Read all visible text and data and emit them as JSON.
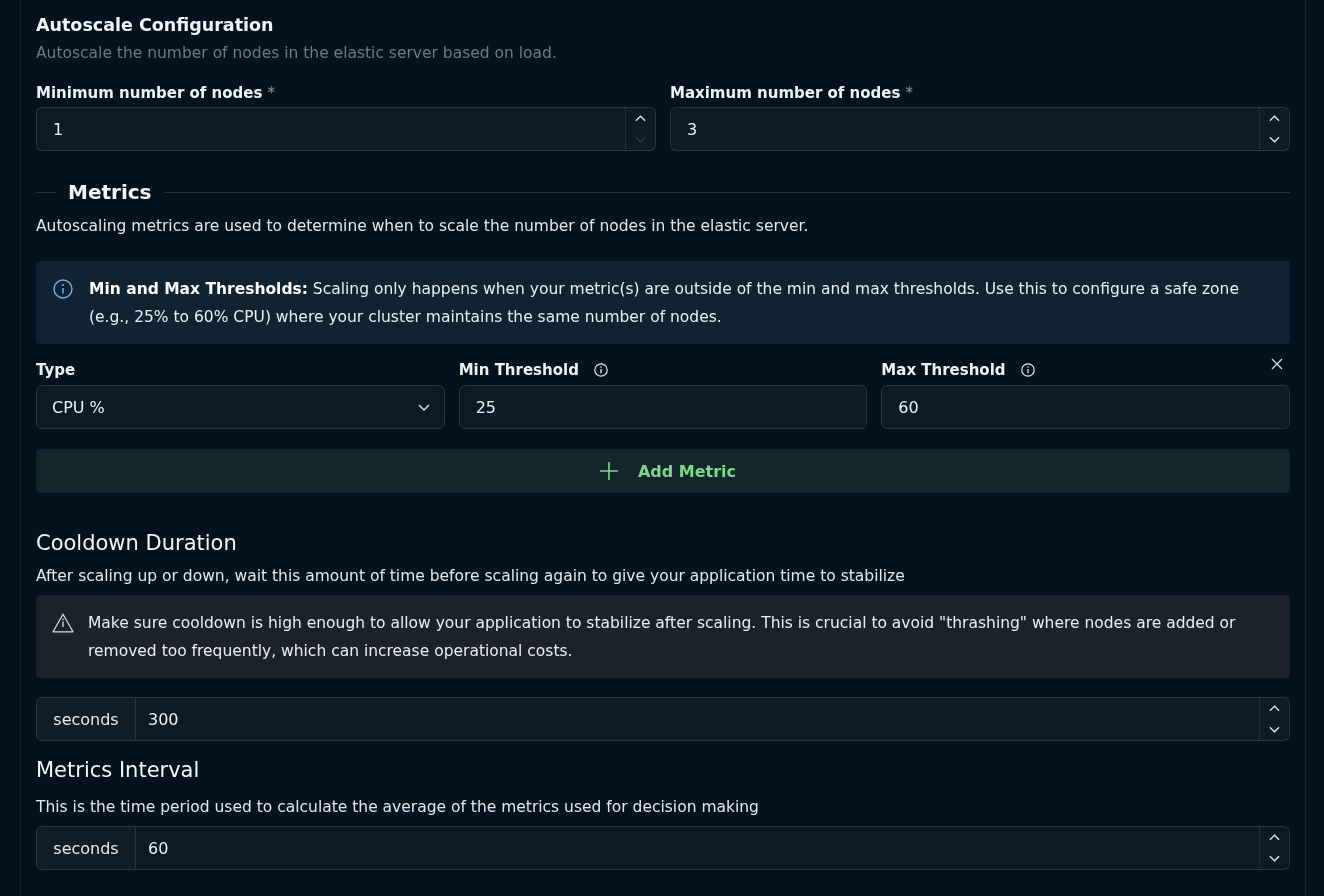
{
  "section": {
    "title": "Autoscale Configuration",
    "description": "Autoscale the number of nodes in the elastic server based on load."
  },
  "node_fields": [
    {
      "label": "Minimum number of nodes",
      "required_mark": "*",
      "value": "1",
      "decrement_disabled": true
    },
    {
      "label": "Maximum number of nodes",
      "required_mark": "*",
      "value": "3",
      "decrement_disabled": false
    }
  ],
  "metrics": {
    "heading": "Metrics",
    "description": "Autoscaling metrics are used to determine when to scale the number of nodes in the elastic server.",
    "info_callout": "**Min and Max Thresholds:** Scaling only happens when your metric(s) are outside of the min and max thresholds. Use this to configure a safe zone (e.g., 25% to 60% CPU) where your cluster maintains the same number of nodes.",
    "rows": [
      {
        "type": {
          "label": "Type",
          "value": "CPU %"
        },
        "min_threshold": {
          "label": "Min Threshold",
          "value": "25"
        },
        "max_threshold": {
          "label": "Max Threshold",
          "value": "60"
        }
      }
    ],
    "add_button": "Add Metric"
  },
  "cooldown": {
    "title": "Cooldown Duration",
    "description": "After scaling up or down, wait this amount of time before scaling again to give your application time to stabilize",
    "warning": "Make sure cooldown is high enough to allow your application to stabilize after scaling. This is crucial to avoid \"thrashing\" where nodes are added or removed too frequently, which can increase operational costs.",
    "unit": "seconds",
    "value": "300"
  },
  "interval": {
    "title": "Metrics Interval",
    "description": "This is the time period used to calculate the average of the metrics used for decision making",
    "unit": "seconds",
    "value": "60"
  }
}
